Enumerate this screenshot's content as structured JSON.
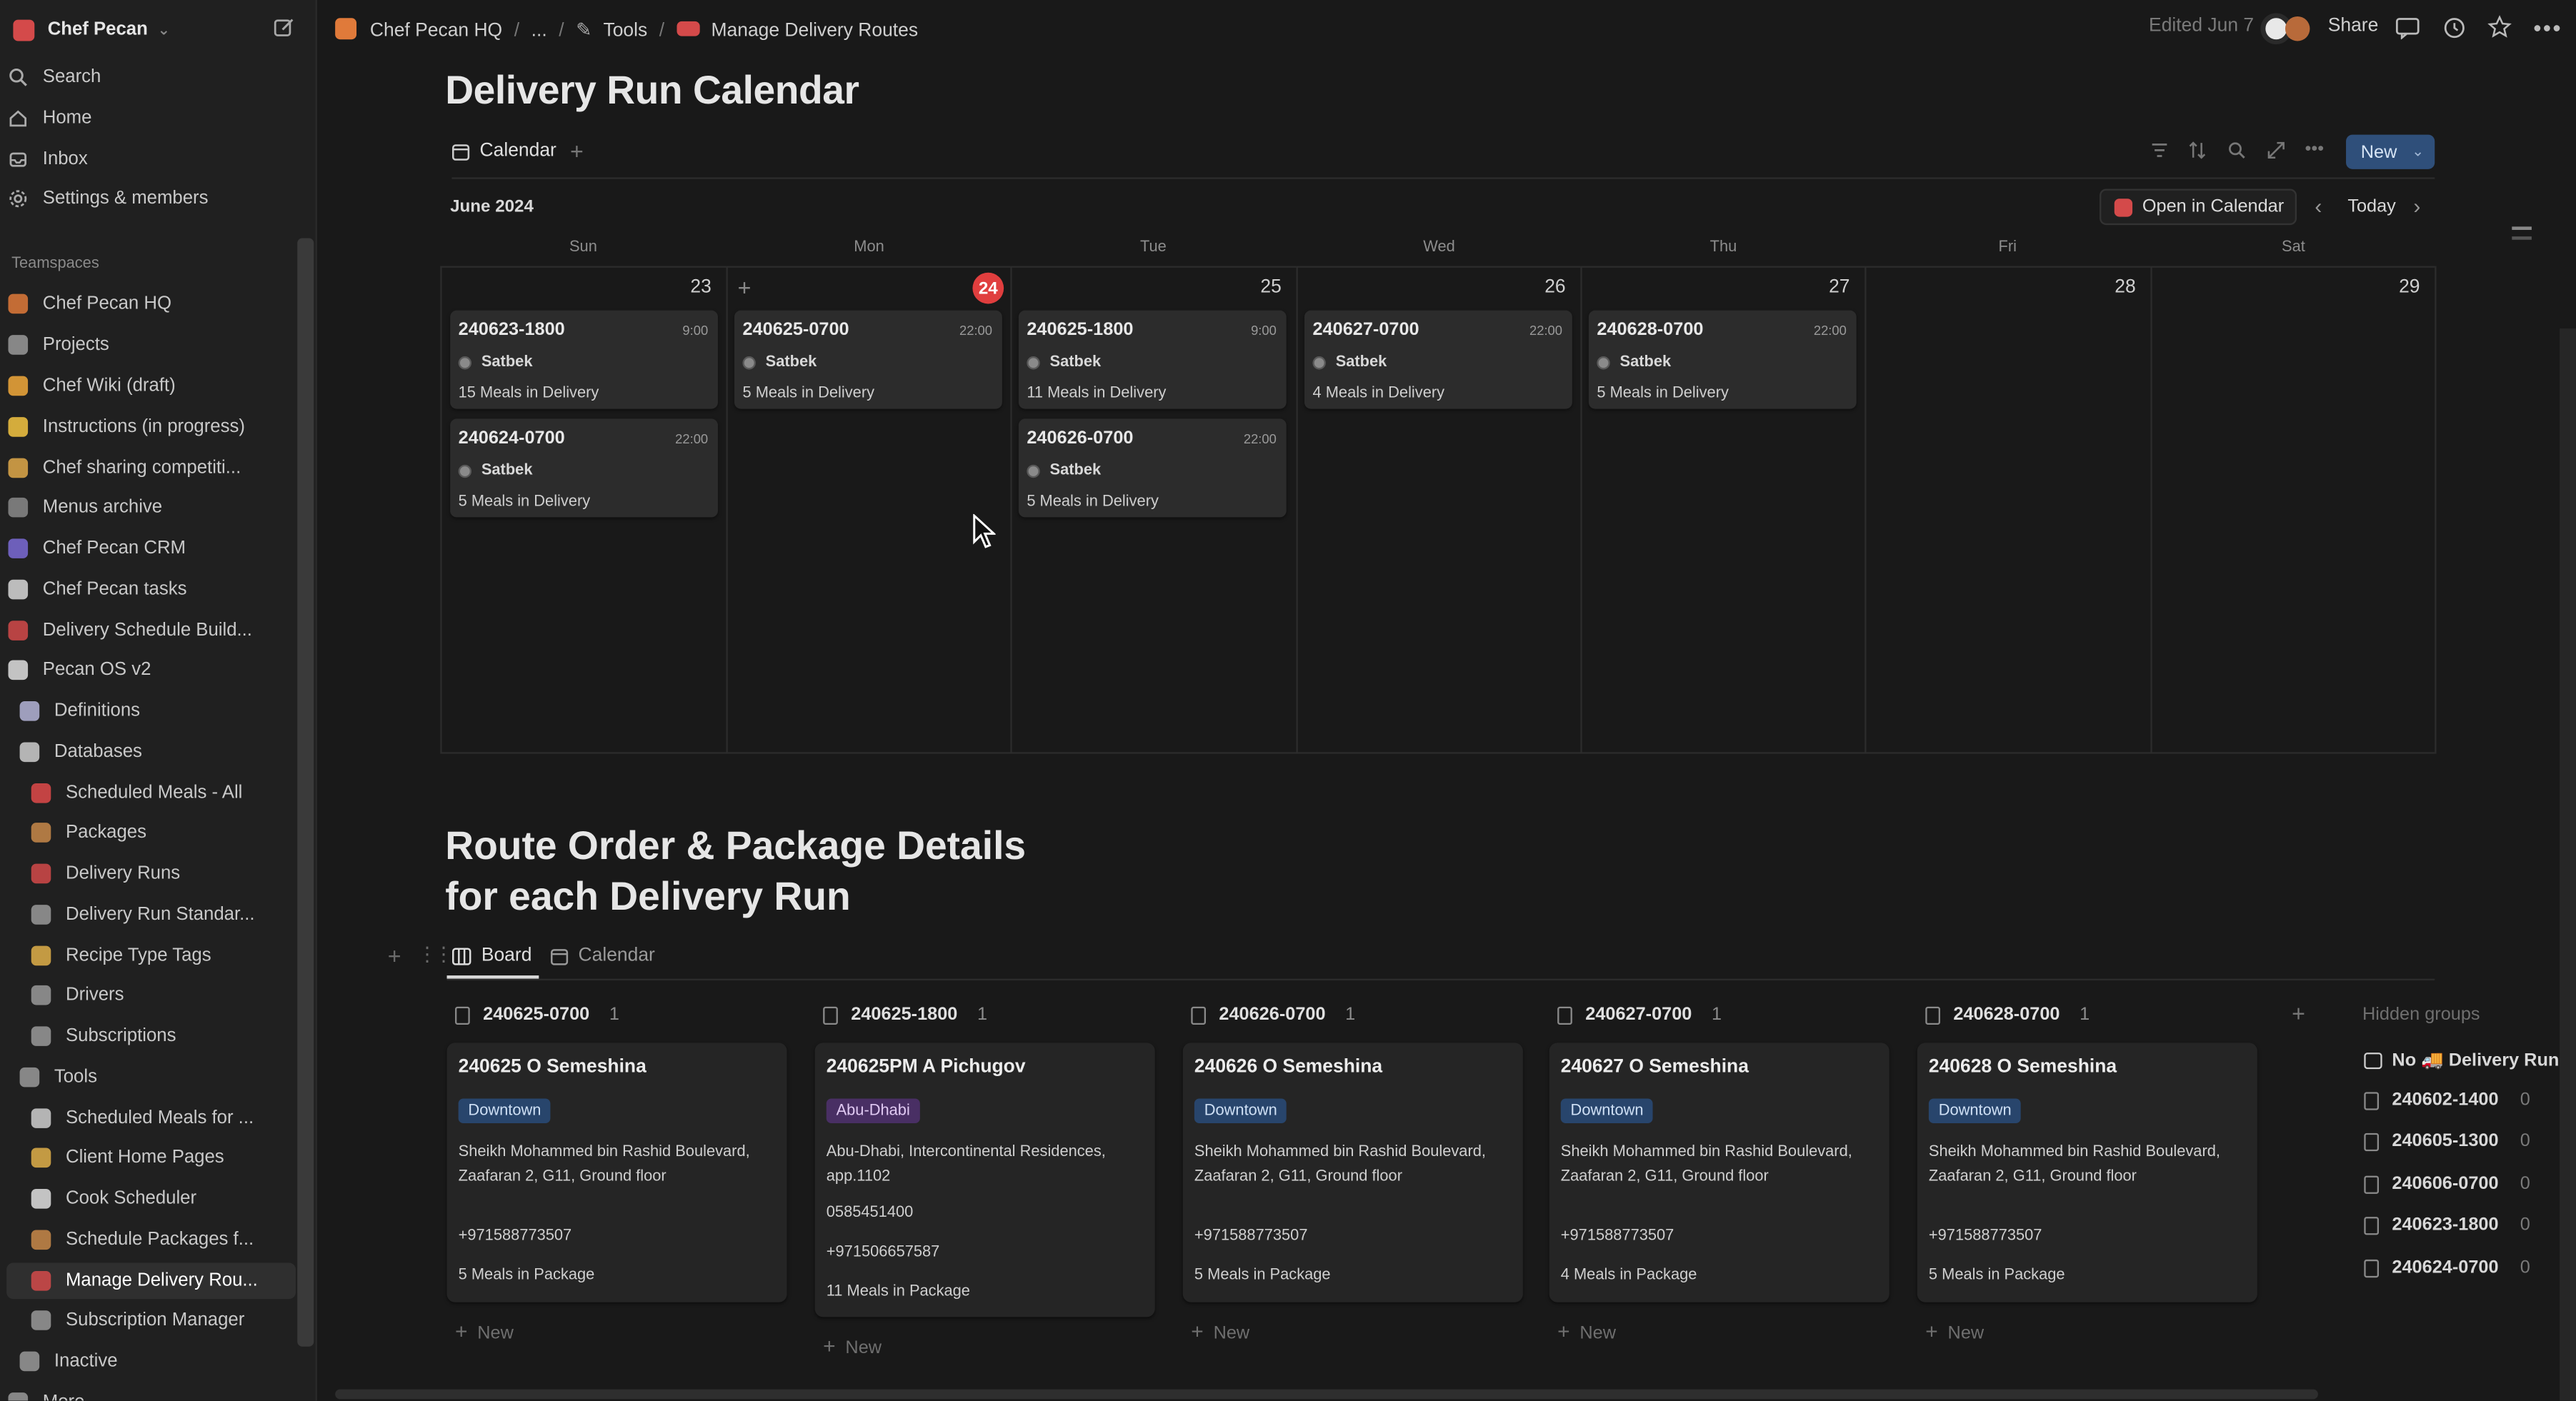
{
  "sidebar": {
    "workspace": "Chef Pecan",
    "search": "Search",
    "home": "Home",
    "inbox": "Inbox",
    "settings": "Settings & members",
    "teamspaces_label": "Teamspaces",
    "items": [
      {
        "label": "Chef Pecan HQ",
        "color": "#e07a3a"
      },
      {
        "label": "Projects",
        "color": "#9a9a9a"
      },
      {
        "label": "Chef Wiki (draft)",
        "color": "#f2a93b"
      },
      {
        "label": "Instructions (in progress)",
        "color": "#f5c542"
      },
      {
        "label": "Chef sharing competiti...",
        "color": "#e0a94a"
      },
      {
        "label": "Menus archive",
        "color": "#8a8a8a"
      },
      {
        "label": "Chef Pecan CRM",
        "color": "#7b6bd6"
      },
      {
        "label": "Chef Pecan tasks",
        "color": "#d8d8d8"
      },
      {
        "label": "Delivery Schedule Build...",
        "color": "#d44a4a"
      },
      {
        "label": "Pecan OS v2",
        "color": "#e0e0e0"
      },
      {
        "label": "Definitions",
        "color": "#b5b5d8"
      },
      {
        "label": "Databases",
        "color": "#cfcfcf"
      },
      {
        "label": "Scheduled Meals - All",
        "color": "#e04a4a"
      },
      {
        "label": "Packages",
        "color": "#c98a4a"
      },
      {
        "label": "Delivery Runs",
        "color": "#d44a4a"
      },
      {
        "label": "Delivery Run Standar...",
        "color": "#9a9a9a"
      },
      {
        "label": "Recipe Type Tags",
        "color": "#e0b04a"
      },
      {
        "label": "Drivers",
        "color": "#9a9a9a"
      },
      {
        "label": "Subscriptions",
        "color": "#9a9a9a"
      },
      {
        "label": "Tools",
        "color": "#9a9a9a"
      },
      {
        "label": "Scheduled Meals for ...",
        "color": "#cfcfcf"
      },
      {
        "label": "Client Home Pages",
        "color": "#e0b04a"
      },
      {
        "label": "Cook Scheduler",
        "color": "#e0e0e0"
      },
      {
        "label": "Schedule Packages f...",
        "color": "#c98a4a"
      },
      {
        "label": "Manage Delivery Rou...",
        "color": "#d44a4a"
      },
      {
        "label": "Subscription Manager",
        "color": "#9a9a9a"
      },
      {
        "label": "Inactive",
        "color": "#9a9a9a"
      },
      {
        "label": "More",
        "color": "#9a9a9a"
      }
    ]
  },
  "topbar": {
    "breadcrumbs": [
      "Chef Pecan HQ",
      "...",
      "Tools",
      "Manage Delivery Routes"
    ],
    "edited": "Edited Jun 7",
    "share": "Share"
  },
  "calendar_section": {
    "title": "Delivery Run Calendar",
    "view_tab": "Calendar",
    "new_button": "New",
    "month": "June 2024",
    "open_in_calendar": "Open in Calendar",
    "today": "Today",
    "weekdays": [
      "Sun",
      "Mon",
      "Tue",
      "Wed",
      "Thu",
      "Fri",
      "Sat"
    ],
    "days": [
      "23",
      "24",
      "25",
      "26",
      "27",
      "28",
      "29"
    ],
    "events": [
      {
        "title": "240623-1800",
        "time": "9:00",
        "driver": "Satbek",
        "meals": "15 Meals in Delivery"
      },
      {
        "title": "240624-0700",
        "time": "22:00",
        "driver": "Satbek",
        "meals": "5 Meals in Delivery"
      },
      {
        "title": "240625-0700",
        "time": "22:00",
        "driver": "Satbek",
        "meals": "5 Meals in Delivery"
      },
      {
        "title": "240625-1800",
        "time": "9:00",
        "driver": "Satbek",
        "meals": "11 Meals in Delivery"
      },
      {
        "title": "240626-0700",
        "time": "22:00",
        "driver": "Satbek",
        "meals": "5 Meals in Delivery"
      },
      {
        "title": "240627-0700",
        "time": "22:00",
        "driver": "Satbek",
        "meals": "4 Meals in Delivery"
      },
      {
        "title": "240628-0700",
        "time": "22:00",
        "driver": "Satbek",
        "meals": "5 Meals in Delivery"
      }
    ]
  },
  "board_section": {
    "title": "Route Order & Package Details\nfor each Delivery Run",
    "tabs": [
      "Board",
      "Calendar"
    ],
    "new_label": "New",
    "columns": [
      {
        "name": "240625-0700",
        "count": "1",
        "card": {
          "title": "240625 O Semeshina",
          "tag": "Downtown",
          "address": "Sheikh Mohammed bin Rashid Boulevard, Zaafaran 2, G11, Ground floor",
          "phone1": "",
          "phone2": "+971588773507",
          "meals": "5 Meals in Package"
        }
      },
      {
        "name": "240625-1800",
        "count": "1",
        "card": {
          "title": "240625PM A Pichugov",
          "tag": "Abu-Dhabi",
          "address": "Abu-Dhabi, Intercontinental Residences, app.1102",
          "phone1": "0585451400",
          "phone2": "+971506657587",
          "meals": "11 Meals in Package"
        }
      },
      {
        "name": "240626-0700",
        "count": "1",
        "card": {
          "title": "240626 O Semeshina",
          "tag": "Downtown",
          "address": "Sheikh Mohammed bin Rashid Boulevard, Zaafaran 2, G11, Ground floor",
          "phone1": "",
          "phone2": "+971588773507",
          "meals": "5 Meals in Package"
        }
      },
      {
        "name": "240627-0700",
        "count": "1",
        "card": {
          "title": "240627 O Semeshina",
          "tag": "Downtown",
          "address": "Sheikh Mohammed bin Rashid Boulevard, Zaafaran 2, G11, Ground floor",
          "phone1": "",
          "phone2": "+971588773507",
          "meals": "4 Meals in Package"
        }
      },
      {
        "name": "240628-0700",
        "count": "1",
        "card": {
          "title": "240628 O Semeshina",
          "tag": "Downtown",
          "address": "Sheikh Mohammed bin Rashid Boulevard, Zaafaran 2, G11, Ground floor",
          "phone1": "",
          "phone2": "+971588773507",
          "meals": "5 Meals in Package"
        }
      }
    ],
    "hidden_groups_label": "Hidden groups",
    "hidden_groups": [
      {
        "name": "No 🚚 Delivery Run",
        "count": ""
      },
      {
        "name": "240602-1400",
        "count": "0"
      },
      {
        "name": "240605-1300",
        "count": "0"
      },
      {
        "name": "240606-0700",
        "count": "0"
      },
      {
        "name": "240623-1800",
        "count": "0"
      },
      {
        "name": "240624-0700",
        "count": "0"
      }
    ]
  },
  "colors": {
    "today_badge": "#e03e3e",
    "tag_downtown_bg": "#28456c",
    "tag_abudhabi_bg": "#492f64",
    "new_button_bg": "#2f4f7a"
  }
}
